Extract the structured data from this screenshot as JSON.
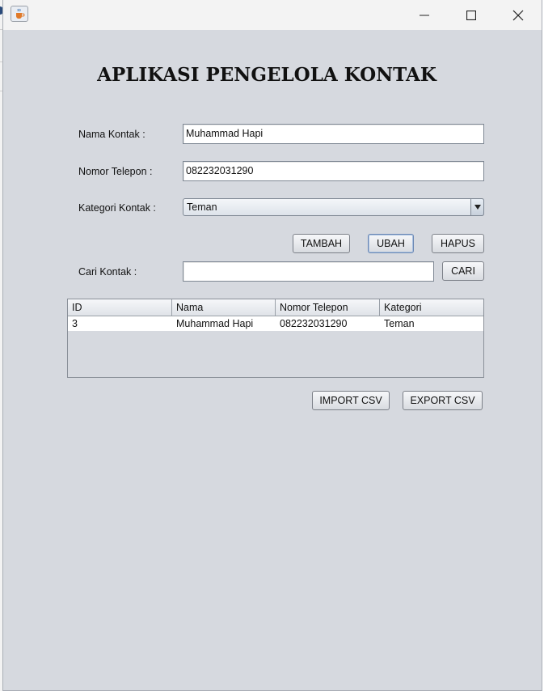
{
  "window": {
    "title": "",
    "app_icon": "java-cup-icon",
    "controls": [
      "minimize-icon",
      "maximize-icon",
      "close-icon"
    ]
  },
  "header": {
    "title": "APLIKASI PENGELOLA KONTAK"
  },
  "form": {
    "nama_label": "Nama Kontak :",
    "nama_value": "Muhammad Hapi",
    "telepon_label": "Nomor Telepon :",
    "telepon_value": "082232031290",
    "kategori_label": "Kategori Kontak :",
    "kategori_value": "Teman"
  },
  "actions": {
    "tambah": "TAMBAH",
    "ubah": "UBAH",
    "hapus": "HAPUS"
  },
  "search": {
    "label": "Cari Kontak :",
    "value": "",
    "button": "CARI"
  },
  "table": {
    "columns": [
      "ID",
      "Nama",
      "Nomor Telepon",
      "Kategori"
    ],
    "rows": [
      [
        "3",
        "Muhammad Hapi",
        "082232031290",
        "Teman"
      ]
    ]
  },
  "csv": {
    "import": "IMPORT CSV",
    "export": "EXPORT CSV"
  },
  "colors": {
    "window_bg": "#d6d9df",
    "titlebar_bg": "#f3f3f3",
    "focus_border": "#6b88b4"
  }
}
